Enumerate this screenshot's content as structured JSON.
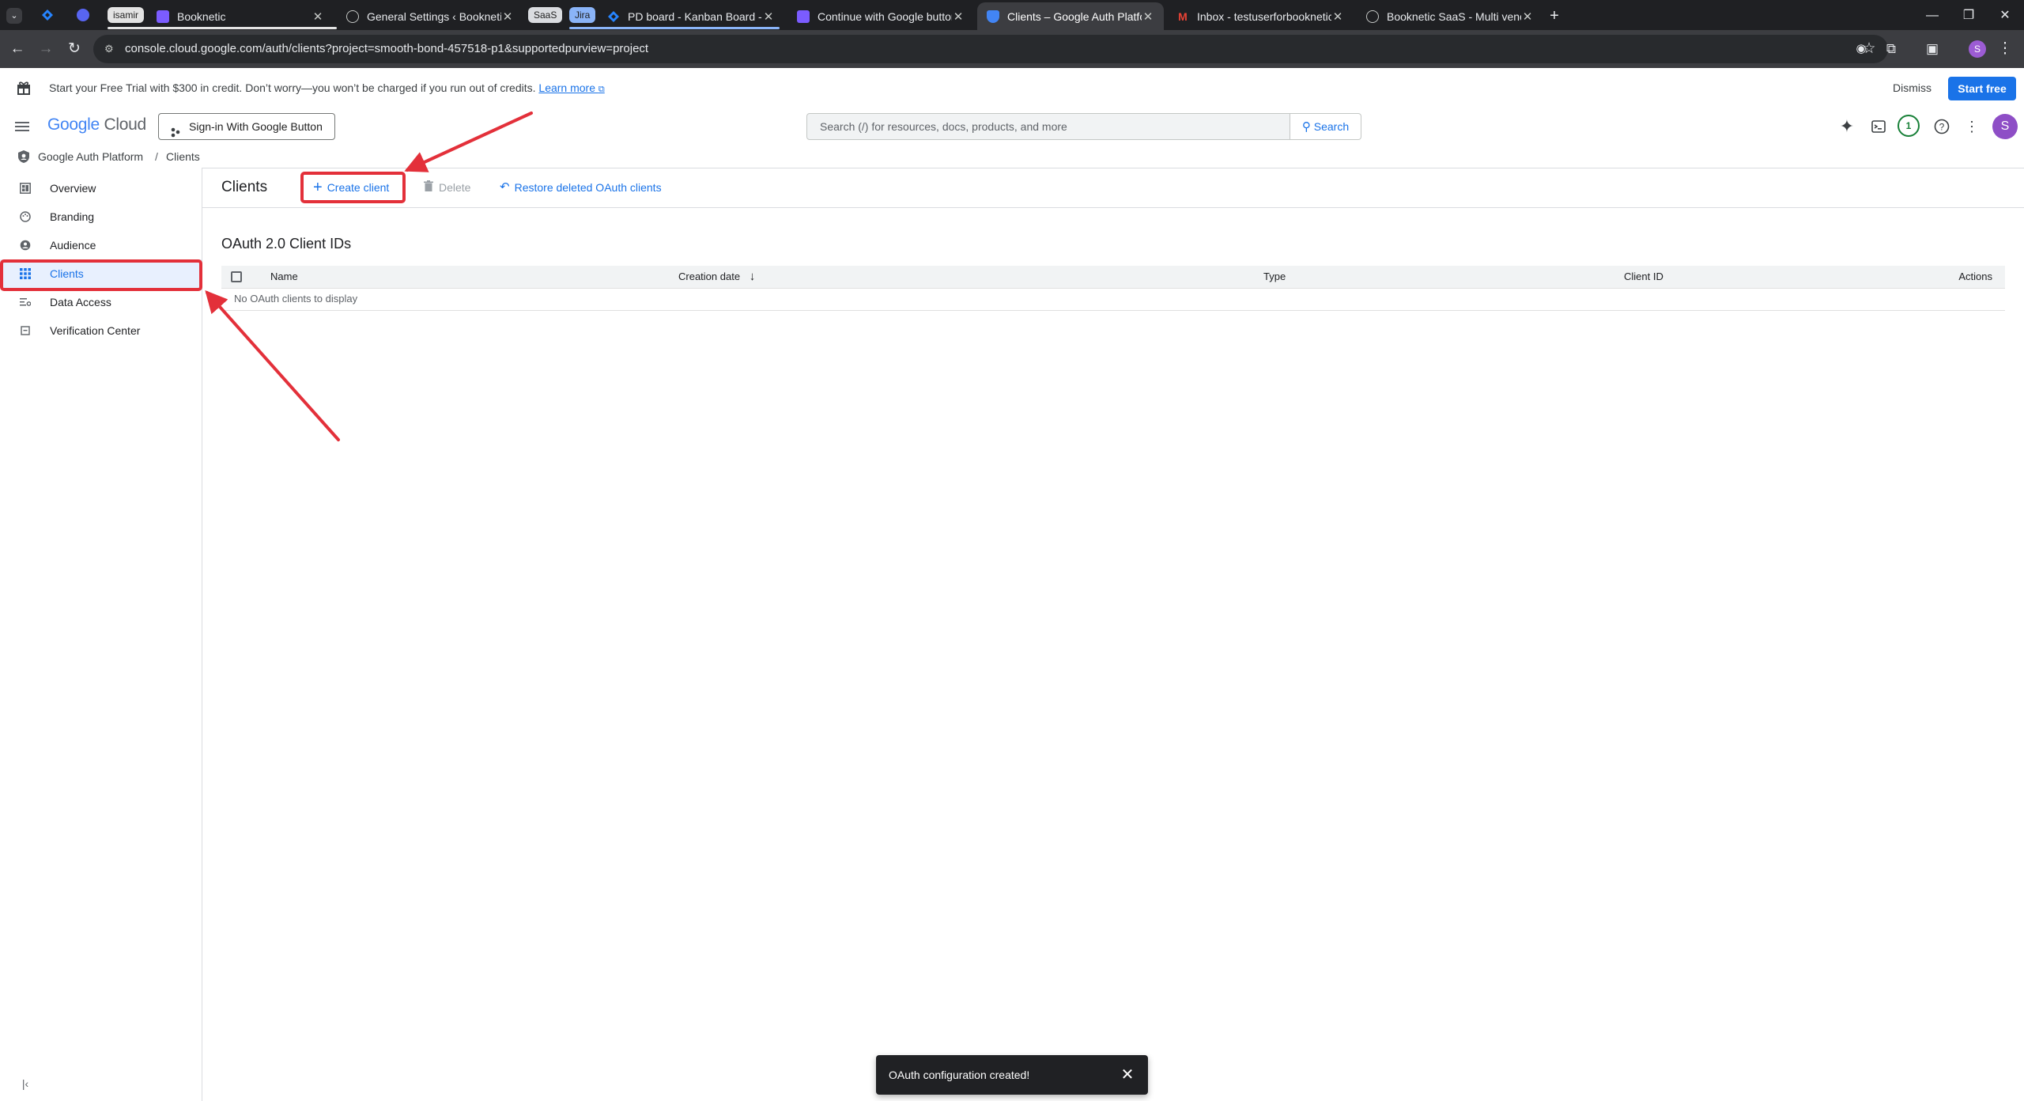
{
  "browser": {
    "tabs": [
      {
        "title": "Booknetic",
        "active": false
      },
      {
        "title": "General Settings ‹ Booknetic —",
        "active": false
      },
      {
        "title": "PD board - Kanban Board - Jira",
        "active": false
      },
      {
        "title": "Continue with Google button",
        "active": false
      },
      {
        "title": "Clients – Google Auth Platform",
        "active": true
      },
      {
        "title": "Inbox - testuserforbooknetic@",
        "active": false
      },
      {
        "title": "Booknetic SaaS - Multi vendor",
        "active": false
      }
    ],
    "groups": {
      "isamir": "isamir",
      "saas": "SaaS",
      "jira": "Jira"
    },
    "url": "console.cloud.google.com/auth/clients?project=smooth-bond-457518-p1&supportedpurview=project",
    "profile_initial": "S"
  },
  "trial_banner": {
    "text": "Start your Free Trial with $300 in credit. Don’t worry—you won’t be charged if you run out of credits.",
    "learn_more": "Learn more",
    "dismiss": "Dismiss",
    "start_free": "Start free"
  },
  "header": {
    "logo_google": "Google",
    "logo_cloud": "Cloud",
    "project": "Sign-in With Google Button",
    "search_placeholder": "Search (/) for resources, docs, products, and more",
    "search_button": "Search",
    "notification_count": "1",
    "avatar_initial": "S"
  },
  "breadcrumb": {
    "root": "Google Auth Platform",
    "separator": "/",
    "current": "Clients"
  },
  "sidebar": {
    "items": [
      {
        "label": "Overview",
        "icon": "dashboard-icon"
      },
      {
        "label": "Branding",
        "icon": "palette-icon"
      },
      {
        "label": "Audience",
        "icon": "person-icon"
      },
      {
        "label": "Clients",
        "icon": "grid-icon",
        "active": true
      },
      {
        "label": "Data Access",
        "icon": "tune-icon"
      },
      {
        "label": "Verification Center",
        "icon": "checklist-icon"
      }
    ]
  },
  "main": {
    "title": "Clients",
    "create_client": "Create client",
    "delete": "Delete",
    "restore": "Restore deleted OAuth clients",
    "section_title": "OAuth 2.0 Client IDs",
    "columns": {
      "name": "Name",
      "creation_date": "Creation date",
      "type": "Type",
      "client_id": "Client ID",
      "actions": "Actions"
    },
    "empty_message": "No OAuth clients to display"
  },
  "toast": {
    "message": "OAuth configuration created!"
  },
  "colors": {
    "accent": "#1a73e8",
    "annotation": "#e3303a",
    "tab_bar": "#1f2023"
  }
}
